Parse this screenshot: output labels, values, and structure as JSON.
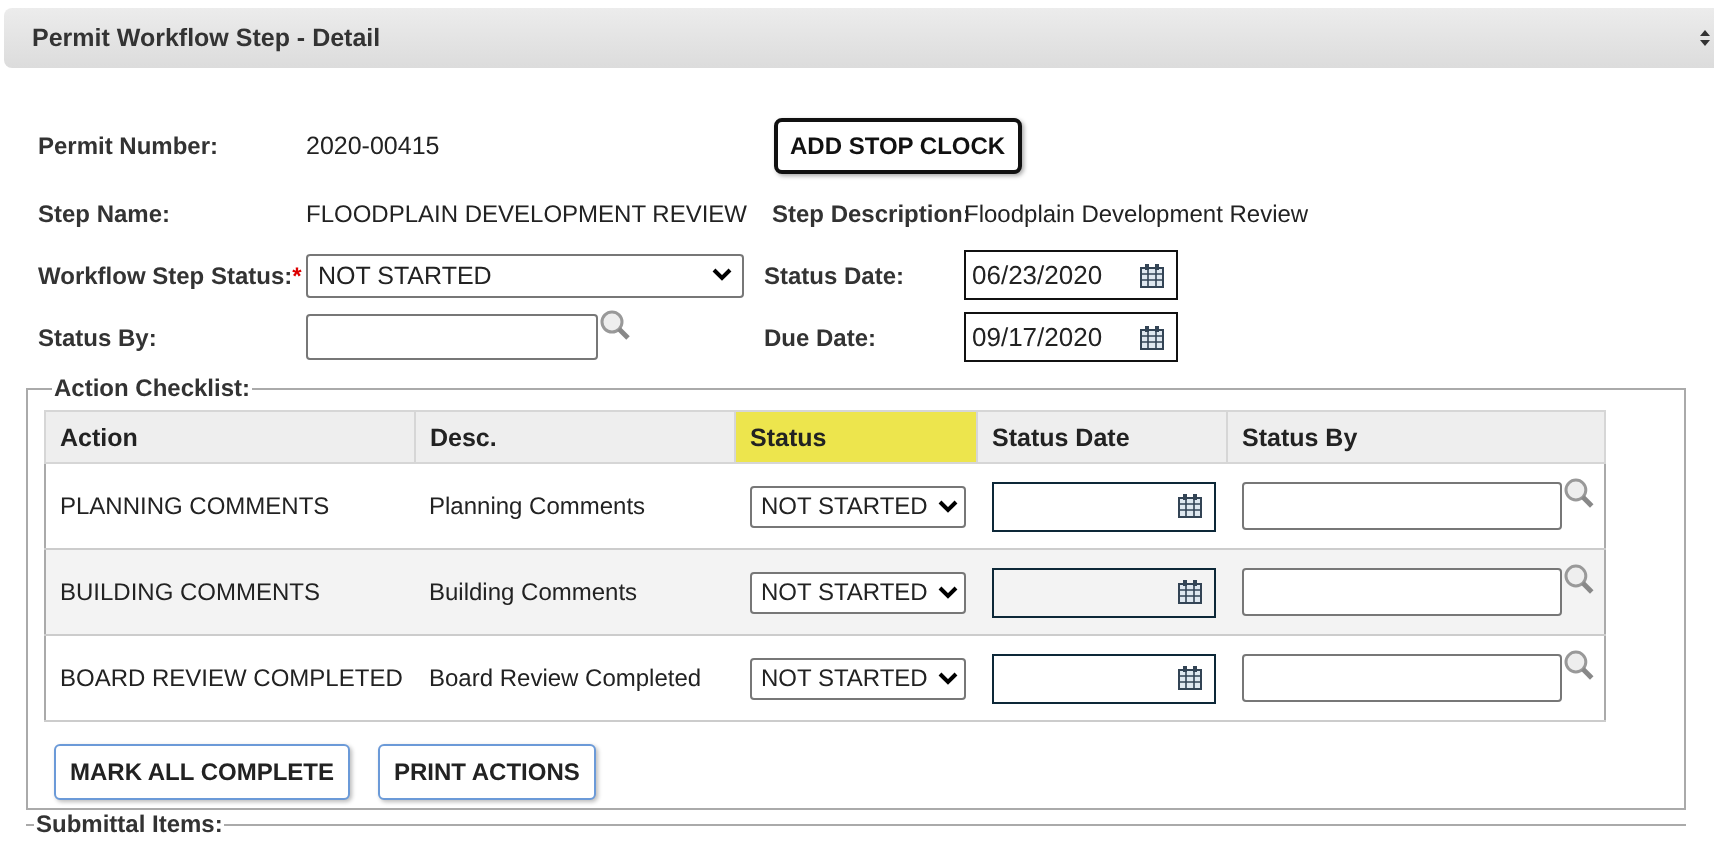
{
  "panel": {
    "title": "Permit Workflow Step - Detail"
  },
  "form": {
    "permit_number_label": "Permit Number:",
    "permit_number": "2020-00415",
    "stop_clock_button": "ADD STOP CLOCK",
    "step_name_label": "Step Name:",
    "step_name": "FLOODPLAIN DEVELOPMENT REVIEW",
    "step_description_label": "Step Description:",
    "step_description": "Floodplain Development Review",
    "status_label": "Workflow Step Status:",
    "required_mark": "*",
    "status_value": "NOT STARTED",
    "status_date_label": "Status Date:",
    "status_date": "06/23/2020",
    "status_by_label": "Status By:",
    "due_date_label": "Due Date:",
    "due_date": "09/17/2020"
  },
  "action_checklist": {
    "legend": "Action Checklist:",
    "columns": [
      {
        "label": "Action",
        "highlighted": false
      },
      {
        "label": "Desc.",
        "highlighted": false
      },
      {
        "label": "Status",
        "highlighted": true
      },
      {
        "label": "Status Date",
        "highlighted": false
      },
      {
        "label": "Status By",
        "highlighted": false
      }
    ],
    "rows": [
      {
        "action": "PLANNING COMMENTS",
        "desc": "Planning Comments",
        "status": "NOT STARTED"
      },
      {
        "action": "BUILDING COMMENTS",
        "desc": "Building Comments",
        "status": "NOT STARTED"
      },
      {
        "action": "BOARD REVIEW COMPLETED",
        "desc": "Board Review Completed",
        "status": "NOT STARTED"
      }
    ],
    "buttons": [
      "MARK ALL COMPLETE",
      "PRINT ACTIONS"
    ]
  },
  "submittal_items": {
    "legend": "Submittal Items:"
  }
}
